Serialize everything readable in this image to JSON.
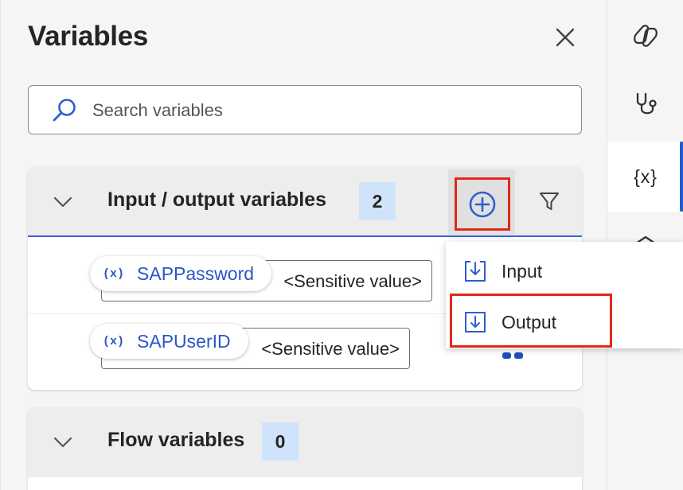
{
  "panel": {
    "title": "Variables",
    "close_label": "Close"
  },
  "search": {
    "placeholder": "Search variables",
    "value": ""
  },
  "io_section": {
    "title": "Input / output variables",
    "count": "2",
    "add_icon": "add-circle-icon",
    "filter_icon": "filter-icon",
    "items": [
      {
        "badge": "(x)",
        "name": "SAPPassword",
        "value": "<Sensitive value>"
      },
      {
        "badge": "(x)",
        "name": "SAPUserID",
        "value": "<Sensitive value>"
      }
    ]
  },
  "flow_section": {
    "title": "Flow variables",
    "count": "0"
  },
  "add_menu": {
    "items": [
      {
        "label": "Input",
        "icon": "input-arrow-icon"
      },
      {
        "label": "Output",
        "icon": "output-arrow-icon"
      }
    ]
  },
  "right_bar": {
    "variables_label": "{x}"
  },
  "colors": {
    "accent": "#1f5fcc",
    "highlight": "#e3271b",
    "count_badge": "#cfe4fa",
    "variable_text": "#2957c7"
  }
}
